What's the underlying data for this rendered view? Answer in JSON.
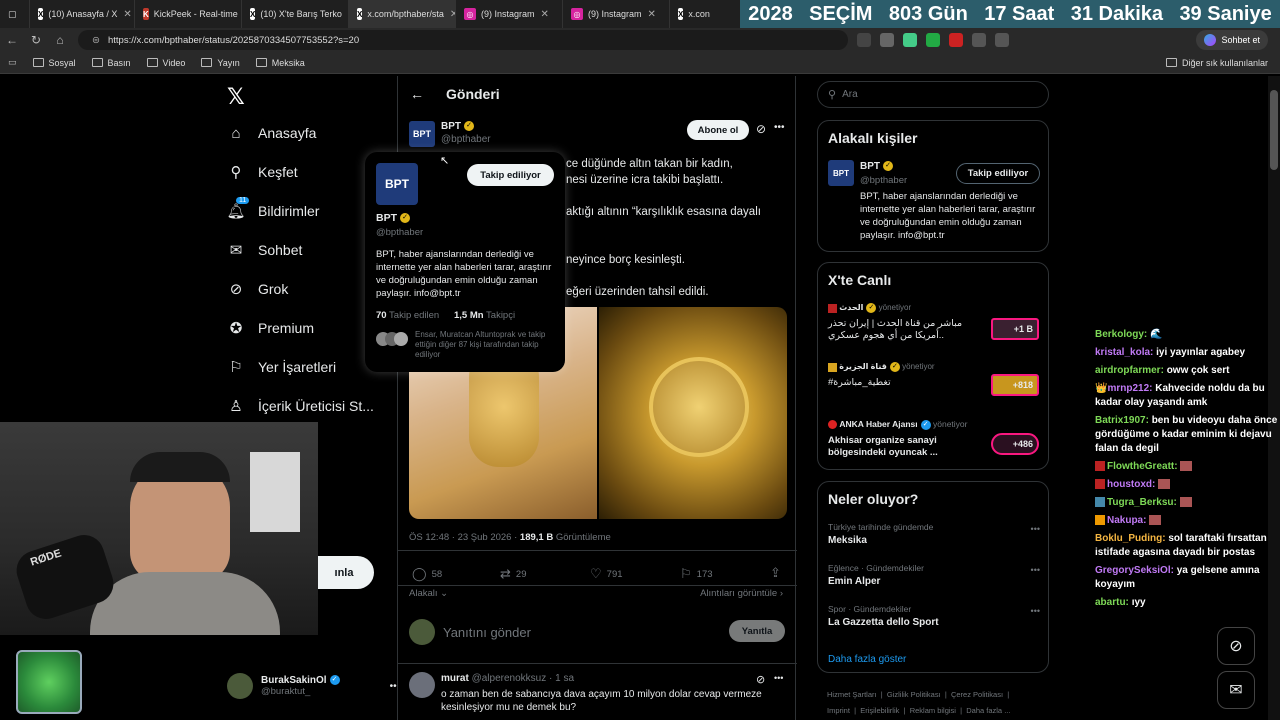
{
  "tabs": [
    {
      "title": "(10) Anasayfa / X",
      "fav": "X"
    },
    {
      "title": "KickPeek - Real-time",
      "fav": "K"
    },
    {
      "title": "(10) X'te Barış Terko",
      "fav": "X"
    },
    {
      "title": "x.com/bpthaber/sta",
      "fav": "X"
    },
    {
      "title": "(9) Instagram",
      "fav": "◎"
    },
    {
      "title": "(9) Instagram",
      "fav": "◎"
    },
    {
      "title": "x.con",
      "fav": "X"
    }
  ],
  "countdown": {
    "year": "2028",
    "label": "SEÇİM",
    "days": "803 Gün",
    "hours": "17 Saat",
    "minutes": "31 Dakika",
    "seconds": "39 Saniye"
  },
  "address": {
    "url": "https://x.com/bpthaber/status/2025870334507753552?s=20",
    "profile": "Sohbet et"
  },
  "bookmarks": {
    "items": [
      "Sosyal",
      "Basın",
      "Video",
      "Yayın",
      "Meksika"
    ],
    "other": "Diğer sık kullanılanlar"
  },
  "nav": {
    "items": [
      "Anasayfa",
      "Keşfet",
      "Bildirimler",
      "Sohbet",
      "Grok",
      "Premium",
      "Yer İşaretleri",
      "İçerik Üreticisi St..."
    ],
    "notif_count": "11",
    "post_btn_fragment": "ınla",
    "account_name": "BurakSakinOl",
    "account_handle": "@buraktut_"
  },
  "post": {
    "header_title": "Gönderi",
    "author_name": "BPT",
    "author_handle": "@bpthaber",
    "subscribe": "Abone ol",
    "line1": "ce düğünde altın takan bir kadın,",
    "line2": "nesi üzerine icra takibi başlattı.",
    "line3": "aktığı altının “karşılıklık esasına dayalı",
    "line4": "neyince borç kesinleşti.",
    "line5": "eğeri üzerinden tahsil edildi.",
    "time": "ÖS 12:48 · 23 Şub 2026 ·",
    "views": "189,1 B",
    "views_label": "Görüntüleme",
    "replies": "58",
    "reposts": "29",
    "likes": "791",
    "bookmarks": "173",
    "sort": "Alakalı",
    "quotes_link": "Alıntıları görüntüle",
    "reply_placeholder": "Yanıtını gönder",
    "reply_btn": "Yanıtla"
  },
  "hovercard": {
    "name": "BPT",
    "handle": "@bpthaber",
    "follow_btn": "Takip ediliyor",
    "bio": "BPT, haber ajanslarından derlediği ve internette yer alan haberleri tarar, araştırır ve doğruluğundan emin olduğu zaman paylaşır. info@bpt.tr",
    "following": "70",
    "following_label": "Takip edilen",
    "followers": "1,5 Mn",
    "followers_label": "Takipçi",
    "followed_by": "Ensar, Muratcan Altuntoprak ve takip ettiğin diğer 87 kişi tarafından takip ediliyor"
  },
  "reply": {
    "name": "murat",
    "handle": "@alperenokksuz · 1 sa",
    "text": "o zaman ben de sabancıya dava açayım 10 milyon dolar cevap vermeze kesinleşiyor mu ne demek bu?"
  },
  "right": {
    "search_placeholder": "Ara",
    "related_title": "Alakalı kişiler",
    "related_name": "BPT",
    "related_handle": "@bpthaber",
    "related_btn": "Takip ediliyor",
    "related_bio": "BPT, haber ajanslarından derlediği ve internette yer alan haberleri tarar, araştırır ve doğruluğundan emin olduğu zaman paylaşır. info@bpt.tr",
    "live_title": "X'te Canlı",
    "live": [
      {
        "host": "الحدث",
        "role": "yönetiyor",
        "text": "مباشر من قناة الحدث | إيران تحذر أمريكا من أي هجوم عسكري..",
        "count": "+1 B"
      },
      {
        "host": "قناة الجزيرة",
        "role": "yönetiyor",
        "text": "#تغطية_مباشرة",
        "count": "+818"
      },
      {
        "host": "ANKA Haber Ajansı",
        "role": "yönetiyor",
        "text": "Akhisar organize sanayi bölgesindeki oyuncak ...",
        "count": "+486"
      }
    ],
    "trends_title": "Neler oluyor?",
    "trends": [
      {
        "context": "Türkiye tarihinde gündemde",
        "name": "Meksika"
      },
      {
        "context": "Eğlence · Gündemdekiler",
        "name": "Emin Alper"
      },
      {
        "context": "Spor · Gündemdekiler",
        "name": "La Gazzetta dello Sport"
      }
    ],
    "show_more": "Daha fazla göster",
    "footer1": [
      "Hizmet Şartları",
      "Gizlilik Politikası",
      "Çerez Politikası"
    ],
    "footer2": [
      "Imprint",
      "Erişilebilirlik",
      "Reklam bilgisi",
      "Daha fazla ..."
    ]
  },
  "chat": [
    {
      "user": "Berkology:",
      "color": "#7ed957",
      "msg": "🌊"
    },
    {
      "user": "kristal_kola:",
      "color": "#c07af5",
      "msg": "iyi yayınlar agabey"
    },
    {
      "user": "airdropfarmer:",
      "color": "#7ed957",
      "msg": "oww çok sert"
    },
    {
      "user": "mrnp212:",
      "color": "#c07af5",
      "msg": "Kahvecide noldu da bu kadar olay yaşandı amk"
    },
    {
      "user": "Batrix1907:",
      "color": "#7ed957",
      "msg": "ben bu videoyu daha önce gördüğüme o kadar eminim ki dejavu falan da degil"
    },
    {
      "user": "FlowtheGreatt:",
      "color": "#7ed957",
      "msg": ""
    },
    {
      "user": "houstoxd:",
      "color": "#c07af5",
      "msg": ""
    },
    {
      "user": "Tugra_Berksu:",
      "color": "#7ed957",
      "msg": ""
    },
    {
      "user": "Nakupa:",
      "color": "#c07af5",
      "msg": ""
    },
    {
      "user": "Boklu_Puding:",
      "color": "#f5b642",
      "msg": "sol taraftaki fırsattan istifade agasına dayadı bir postas"
    },
    {
      "user": "GregorySeksiOl:",
      "color": "#c07af5",
      "msg": "ya gelsene amına koyayım"
    },
    {
      "user": "abartu:",
      "color": "#7ed957",
      "msg": "ıyy"
    }
  ]
}
